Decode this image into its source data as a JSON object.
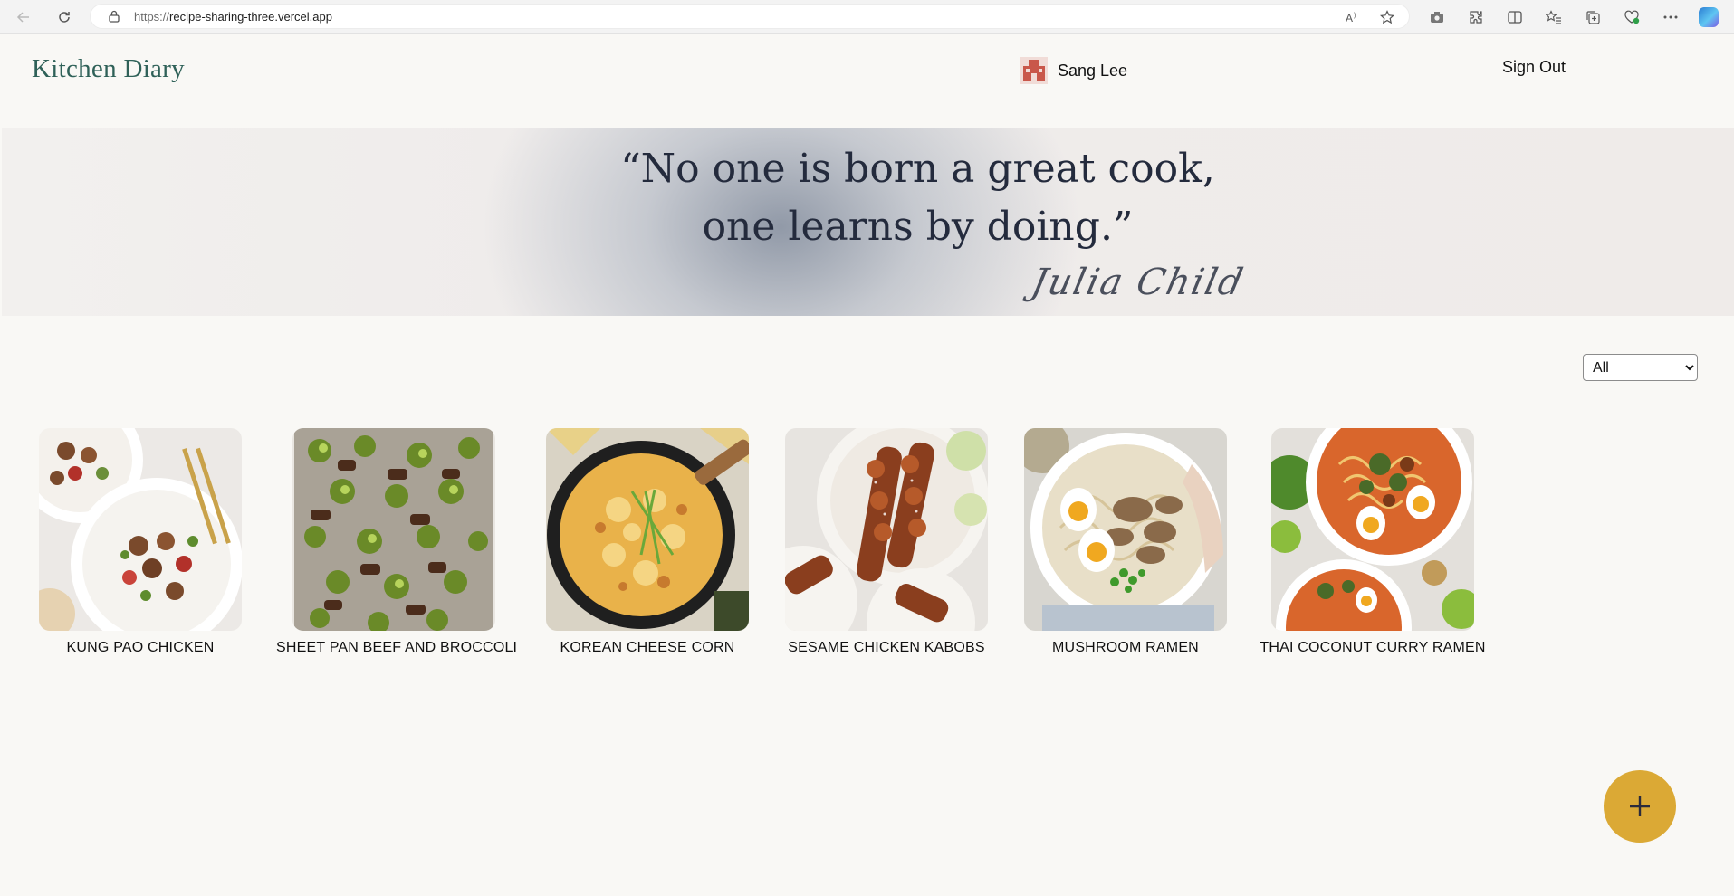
{
  "browser": {
    "url_scheme": "https://",
    "url_host": "recipe-sharing-three.vercel.app",
    "nav_icons": [
      "back-icon",
      "reload-icon"
    ],
    "address_icons": [
      "read-aloud-icon",
      "favorite-star-icon"
    ],
    "toolbar_icons": [
      "screenshot-icon",
      "extensions-icon",
      "split-screen-icon",
      "favorites-icon",
      "collections-icon",
      "browser-essentials-icon",
      "more-icon",
      "copilot-icon"
    ]
  },
  "header": {
    "brand": "Kitchen Diary",
    "user_name": "Sang Lee",
    "sign_out_label": "Sign Out"
  },
  "hero": {
    "quote_line_1": "“No one is born a great cook,",
    "quote_line_2": "one learns by doing.”",
    "author": "Julia Child"
  },
  "filter": {
    "selected": "All"
  },
  "recipes": [
    {
      "title": "KUNG PAO CHICKEN"
    },
    {
      "title": "SHEET PAN BEEF AND BROCCOLI"
    },
    {
      "title": "KOREAN CHEESE CORN"
    },
    {
      "title": "SESAME CHICKEN KABOBS"
    },
    {
      "title": "MUSHROOM RAMEN"
    },
    {
      "title": "THAI COCONUT CURRY RAMEN"
    }
  ],
  "fab": {
    "icon": "plus-icon"
  },
  "colors": {
    "brand": "#2f6158",
    "fab": "#dba935",
    "quote_text": "#242b3d",
    "page_background": "#f9f8f5"
  }
}
